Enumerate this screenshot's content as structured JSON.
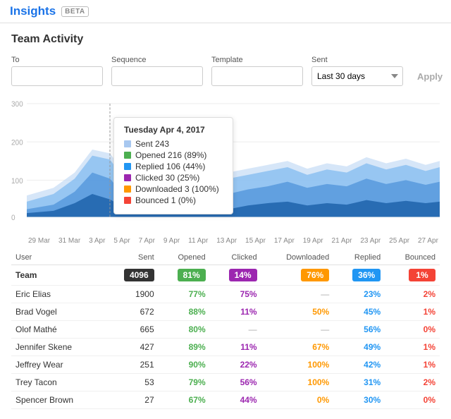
{
  "header": {
    "title": "Insights",
    "beta": "BETA"
  },
  "page": {
    "title": "Team Activity"
  },
  "filters": {
    "to_label": "To",
    "to_placeholder": "",
    "sequence_label": "Sequence",
    "sequence_placeholder": "",
    "template_label": "Template",
    "template_placeholder": "",
    "sent_label": "Sent",
    "sent_value": "Last 30 days",
    "apply_label": "Apply"
  },
  "tooltip": {
    "date": "Tuesday Apr 4, 2017",
    "rows": [
      {
        "label": "Sent 243",
        "color": "#a8c8f0"
      },
      {
        "label": "Opened 216 (89%)",
        "color": "#4caf50"
      },
      {
        "label": "Replied 106 (44%)",
        "color": "#2196f3"
      },
      {
        "label": "Clicked 30 (25%)",
        "color": "#9c27b0"
      },
      {
        "label": "Downloaded 3 (100%)",
        "color": "#ff9800"
      },
      {
        "label": "Bounced 1 (0%)",
        "color": "#f44336"
      }
    ]
  },
  "x_labels": [
    "29 Mar",
    "31 Mar",
    "3 Apr",
    "5 Apr",
    "7 Apr",
    "9 Apr",
    "11 Apr",
    "13 Apr",
    "15 Apr",
    "17 Apr",
    "19 Apr",
    "21 Apr",
    "23 Apr",
    "25 Apr",
    "27 Apr"
  ],
  "table": {
    "columns": [
      "User",
      "Sent",
      "Opened",
      "Clicked",
      "Downloaded",
      "Replied",
      "Bounced"
    ],
    "team_row": {
      "user": "Team",
      "sent": "4096",
      "opened": "81%",
      "opened_color": "#4caf50",
      "clicked": "14%",
      "clicked_color": "#9c27b0",
      "downloaded": "76%",
      "downloaded_color": "#ff9800",
      "replied": "36%",
      "replied_color": "#2196f3",
      "bounced": "1%",
      "bounced_color": "#f44336"
    },
    "rows": [
      {
        "user": "Eric Elias",
        "sent": 1900,
        "opened": "77%",
        "oc": "#4caf50",
        "clicked": "75%",
        "cc": "#9c27b0",
        "downloaded": "—",
        "dc": null,
        "replied": "23%",
        "rc": "#2196f3",
        "bounced": "2%",
        "bc": "#f44336"
      },
      {
        "user": "Brad Vogel",
        "sent": 672,
        "opened": "88%",
        "oc": "#4caf50",
        "clicked": "11%",
        "cc": "#9c27b0",
        "downloaded": "50%",
        "dc": "#ff9800",
        "replied": "45%",
        "rc": "#2196f3",
        "bounced": "1%",
        "bc": "#f44336"
      },
      {
        "user": "Olof Mathé",
        "sent": 665,
        "opened": "80%",
        "oc": "#4caf50",
        "clicked": "—",
        "cc": null,
        "downloaded": "—",
        "dc": null,
        "replied": "56%",
        "rc": "#2196f3",
        "bounced": "0%",
        "bc": "#f44336"
      },
      {
        "user": "Jennifer Skene",
        "sent": 427,
        "opened": "89%",
        "oc": "#4caf50",
        "clicked": "11%",
        "cc": "#9c27b0",
        "downloaded": "67%",
        "dc": "#ff9800",
        "replied": "49%",
        "rc": "#2196f3",
        "bounced": "1%",
        "bc": "#f44336"
      },
      {
        "user": "Jeffrey Wear",
        "sent": 251,
        "opened": "90%",
        "oc": "#4caf50",
        "clicked": "22%",
        "cc": "#9c27b0",
        "downloaded": "100%",
        "dc": "#ff9800",
        "replied": "42%",
        "rc": "#2196f3",
        "bounced": "1%",
        "bc": "#f44336"
      },
      {
        "user": "Trey Tacon",
        "sent": 53,
        "opened": "79%",
        "oc": "#4caf50",
        "clicked": "56%",
        "cc": "#9c27b0",
        "downloaded": "100%",
        "dc": "#ff9800",
        "replied": "31%",
        "rc": "#2196f3",
        "bounced": "2%",
        "bc": "#f44336"
      },
      {
        "user": "Spencer Brown",
        "sent": 27,
        "opened": "67%",
        "oc": "#4caf50",
        "clicked": "44%",
        "cc": "#9c27b0",
        "downloaded": "0%",
        "dc": "#ff9800",
        "replied": "30%",
        "rc": "#2196f3",
        "bounced": "0%",
        "bc": "#f44336"
      }
    ]
  }
}
